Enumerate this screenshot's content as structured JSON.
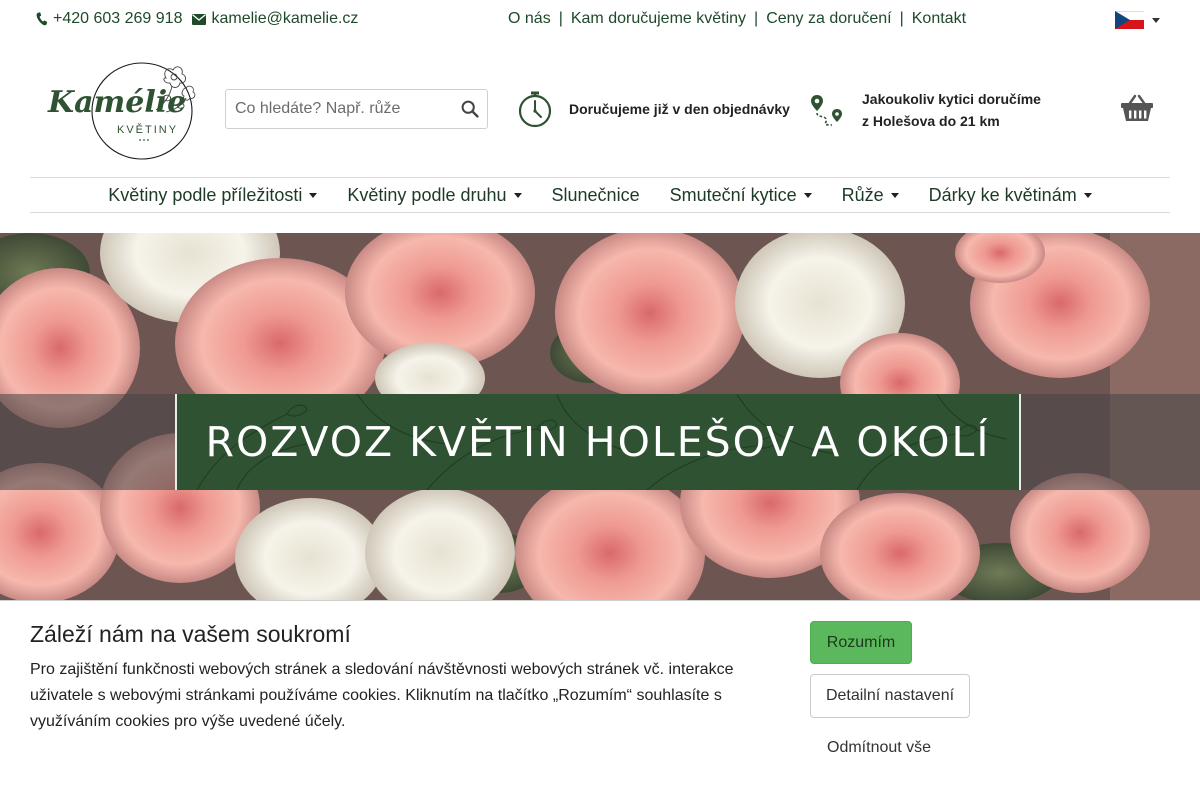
{
  "topbar": {
    "phone": "+420 603 269 918",
    "email": "kamelie@kamelie.cz",
    "links": [
      "O nás",
      "Kam doručujeme květiny",
      "Ceny za doručení",
      "Kontakt"
    ],
    "separator": "|",
    "language_icon": "czech-flag-icon"
  },
  "logo": {
    "name": "Kamélie",
    "tagline": "KVĚTINY"
  },
  "search": {
    "placeholder": "Co hledáte? Např. růže",
    "icon": "search-icon"
  },
  "features": {
    "delivery_time": "Doručujeme již v den objednávky",
    "delivery_area_line1": "Jakoukoliv kytici doručíme",
    "delivery_area_line2": "z Holešova do 21 km"
  },
  "cart": {
    "icon": "basket-icon"
  },
  "nav": {
    "items": [
      {
        "label": "Květiny podle příležitosti",
        "dropdown": true
      },
      {
        "label": "Květiny podle druhu",
        "dropdown": true
      },
      {
        "label": "Slunečnice",
        "dropdown": false
      },
      {
        "label": "Smuteční kytice",
        "dropdown": true
      },
      {
        "label": "Růže",
        "dropdown": true
      },
      {
        "label": "Dárky ke květinám",
        "dropdown": true
      }
    ]
  },
  "hero": {
    "title": "ROZVOZ KVĚTIN HOLEŠOV A OKOLÍ"
  },
  "cookie": {
    "title": "Záleží nám na vašem soukromí",
    "text": "Pro zajištění funkčnosti webových stránek a sledování návštěvnosti webových stránek vč. interakce uživatele s webovými stránkami používáme cookies. Kliknutím na tlačítko „Rozumím“ souhlasíte s využíváním cookies pro výše uvedené účely.",
    "accept": "Rozumím",
    "details": "Detailní nastavení",
    "reject": "Odmítnout vše"
  },
  "colors": {
    "brand_green": "#2f5233",
    "link_green": "#1e4a2a",
    "accept_green": "#5cb85c"
  }
}
